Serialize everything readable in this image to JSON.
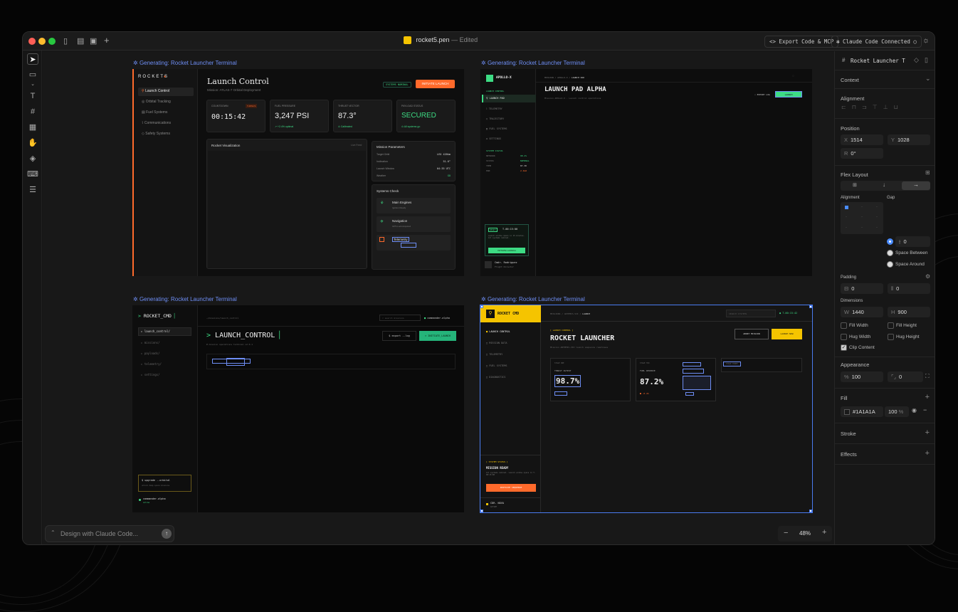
{
  "app": {
    "file_name": "rocket5.pen",
    "edited_status": "— Edited",
    "export_label": "Export Code & MCP",
    "claude_status": "Claude Code Connected"
  },
  "canvas": {
    "frame_label": "Generating: Rocket Launcher Terminal",
    "zoom": "48%"
  },
  "prompt": {
    "placeholder": "Design with Claude Code..."
  },
  "frame1": {
    "brand": "ROCKETS",
    "nav": [
      "Launch Control",
      "Orbital Tracking",
      "Fuel Systems",
      "Communications",
      "Safety Systems"
    ],
    "title": "Launch Control",
    "subtitle": "Mission: ATLAS-7 Orbital Deployment",
    "status_badge": "SYSTEMS NOMINAL",
    "initiate": "INITIATE LAUNCH",
    "stats": [
      {
        "label": "COUNTDOWN",
        "value": "00:15:42",
        "badge": "T-MINUS"
      },
      {
        "label": "FUEL PRESSURE",
        "value": "3,247 PSI",
        "note": "↗ +2.4% optimal"
      },
      {
        "label": "THRUST VECTOR",
        "value": "87.3°",
        "note": "⊙ Calibrated"
      },
      {
        "label": "PAYLOAD STATUS",
        "value": "SECURED",
        "note": "⊙ All systems go"
      }
    ],
    "viz_title": "Rocket Visualization",
    "viz_tag": "Live Feed",
    "params_title": "Mission Parameters",
    "params": [
      [
        "Target Orbit",
        "LEO 420km"
      ],
      [
        "Inclination",
        "51.6°"
      ],
      [
        "Launch Window",
        "04:35 UTC"
      ],
      [
        "Weather",
        "GO"
      ]
    ],
    "checks_title": "Systems Check",
    "checks": [
      [
        "Main Engines",
        "Ignition Ready"
      ],
      [
        "Navigation",
        "GPS Lock Acquired"
      ],
      [
        "Telemetry",
        ""
      ]
    ]
  },
  "frame2": {
    "brand": "APOLLO-X",
    "section": "LAUNCH CONTROL",
    "nav": [
      "LAUNCH PAD",
      "TELEMETRY",
      "TRAJECTORY",
      "FUEL SYSTEMS",
      "SETTINGS"
    ],
    "status_title": "SYSTEM STATUS",
    "status": [
      [
        "NETWORK",
        "98.2%"
      ],
      [
        "STATUS",
        "NOMINAL"
      ],
      [
        "TEMP",
        "87.3K"
      ],
      [
        "PWR",
        "2.4GW"
      ]
    ],
    "ready": "READY",
    "ready_time": "T-00:15:00",
    "ready_text": "Launch window opens in 15 minutes. All systems nominal.",
    "init": "INITIATE LAUNCH",
    "user": "Cmdr. Rodriguez",
    "user_role": "Flight Director",
    "crumb": [
      "MISSION",
      "APOLLO-X",
      "LAUNCH PAD"
    ],
    "title": "LAUNCH PAD ALPHA",
    "subtitle": "Mission APOLLO-X · Launch control operations",
    "export": "EXPORT LOG",
    "launch": "LAUNCH"
  },
  "frame3": {
    "brand": "ROCKET_CMD",
    "nav": [
      "launch_control/",
      "missions/",
      "payloads/",
      "telemetry/",
      "settings/"
    ],
    "path": "~/missions/launch_control",
    "search": "search missions",
    "user_tag": "commander.alpha",
    "title": "LAUNCH_CONTROL",
    "subtitle": "# mission operations terminal v2.0.1",
    "export": "$ export --log",
    "init": "> INITIATE_LAUNCH",
    "upgrade": "$ upgrade --orbital",
    "upgrade_sub": "unlock deep space missions",
    "user": "commander.alpha",
    "user_sub": "online"
  },
  "frame4": {
    "brand": "ROCKET CMD",
    "nav": [
      "LAUNCH CONTROL",
      "MISSION DATA",
      "TELEMETRY",
      "FUEL SYSTEMS",
      "DIAGNOSTICS"
    ],
    "crumb": [
      "MISSIONS",
      "ARTEMIS-VII",
      "LAUNCH"
    ],
    "search": "SEARCH SYSTEMS",
    "time": "T-00:15:42",
    "tag": "[ LAUNCH CONTROL ]",
    "title": "ROCKET LAUNCHER",
    "subtitle": "Mission ARTEMIS-VII launch sequence readiness",
    "abort": "ABORT MISSION",
    "launch": "LAUNCH NOW",
    "m1_tag": "STAGE ONE",
    "m1_label": "THRUST OUTPUT",
    "m1_value": "98.7%",
    "m2_tag": "STAGE TWO",
    "m2_label": "FUEL RESERVE",
    "m2_value": "87.2%",
    "m2_note": "-0.4%",
    "m3_tag": "STAGE THREE",
    "status_tag": "[ SYSTEM STATUS ]",
    "status_title": "MISSION READY",
    "status_text": "All systems nominal. Launch window opens in T-00:15:00",
    "init": "INITIATE SEQUENCE",
    "user": "CDR. NOVA",
    "user_sub": "ACTIVE"
  },
  "panel": {
    "layer_name": "Rocket Launcher T",
    "context": "Context",
    "alignment": "Alignment",
    "position": "Position",
    "x": "1514",
    "y": "1028",
    "rotation": "0°",
    "flex": "Flex Layout",
    "align_label": "Alignment",
    "gap_label": "Gap",
    "gap": "0",
    "space_between": "Space Between",
    "space_around": "Space Around",
    "padding": "Padding",
    "pad_v": "0",
    "pad_h": "0",
    "dimensions": "Dimensions",
    "w": "1440",
    "h": "900",
    "fill_width": "Fill Width",
    "fill_height": "Fill Height",
    "hug_width": "Hug Width",
    "hug_height": "Hug Height",
    "clip": "Clip Content",
    "appearance": "Appearance",
    "opacity": "100",
    "radius": "0",
    "fill": "Fill",
    "fill_hex": "#1A1A1A",
    "fill_opacity": "100",
    "percent": "%",
    "stroke": "Stroke",
    "effects": "Effects"
  },
  "colors": {
    "accent_blue": "#6e8ef5",
    "orange": "#ff6a2b",
    "green": "#3ddc84",
    "yellow": "#f5c400",
    "frame_bg": "#101010"
  }
}
